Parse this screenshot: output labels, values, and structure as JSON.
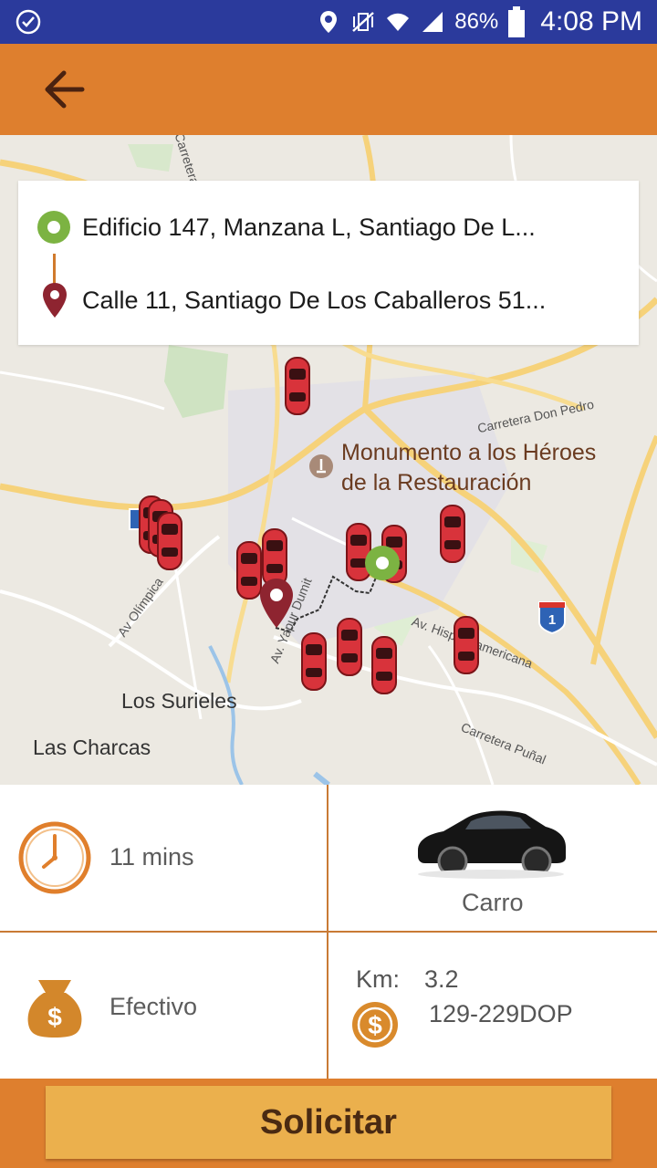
{
  "status_bar": {
    "battery": "86%",
    "time": "4:08 PM"
  },
  "toolbar": {
    "back_icon": "arrow-left-icon"
  },
  "route": {
    "origin": "Edificio 147,  Manzana L,  Santiago De L...",
    "destination": "Calle 11,  Santiago De Los Caballeros 51..."
  },
  "map": {
    "poi_line1": "Monumento a los Héroes",
    "poi_line2": "de la Restauración",
    "place_1": "Los Surieles",
    "place_2": "Las Charcas",
    "road_1": "Carretera Don Pedro",
    "road_2": "Av. Hispanoamericana",
    "road_3": "Carretera Puñal",
    "road_4": "Av. Yapur Dumit",
    "road_5": "Av Olímpica",
    "road_6": "Carretera La Cié",
    "highway_shield": "1"
  },
  "info": {
    "duration": "11 mins",
    "vehicle": "Carro",
    "payment": "Efectivo",
    "km_label": "Km:",
    "km_value": "3.2",
    "fare": "129-229DOP"
  },
  "action": {
    "request_label": "Solicitar"
  },
  "colors": {
    "status_bar": "#2b3a9c",
    "accent": "#de7f2e",
    "button": "#ebb04d",
    "origin": "#7cb342",
    "destination": "#8e2430"
  }
}
